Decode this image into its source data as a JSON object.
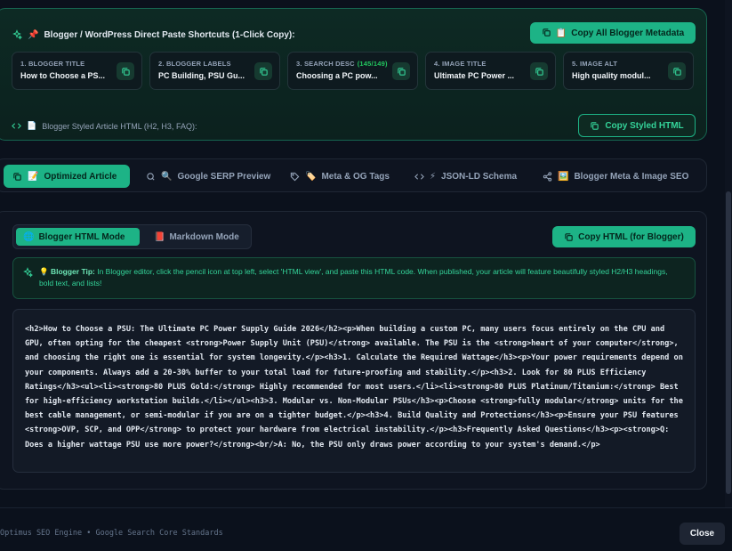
{
  "shortcuts": {
    "pin_emoji": "📌",
    "title": "Blogger / WordPress Direct Paste Shortcuts (1-Click Copy):",
    "copy_all_emoji": "📋",
    "copy_all_label": "Copy All Blogger Metadata",
    "fields": [
      {
        "label": "1. BLOGGER TITLE",
        "count": "",
        "value": "How to Choose a PS..."
      },
      {
        "label": "2. BLOGGER LABELS",
        "count": "",
        "value": "PC Building, PSU Gu..."
      },
      {
        "label": "3. SEARCH DESC",
        "count": "(145/149)",
        "value": "Choosing a PC pow..."
      },
      {
        "label": "4. IMAGE TITLE",
        "count": "",
        "value": "Ultimate PC Power ..."
      },
      {
        "label": "5. IMAGE ALT",
        "count": "",
        "value": "High quality modul..."
      }
    ],
    "styled_emoji": "📄",
    "styled_label": "Blogger Styled Article HTML (H2, H3, FAQ):",
    "copy_styled_label": "Copy Styled HTML"
  },
  "tabs": [
    {
      "emoji": "📝",
      "label": "Optimized Article",
      "icon": "document-icon"
    },
    {
      "emoji": "🔍",
      "label": "Google SERP Preview",
      "icon": "search-icon"
    },
    {
      "emoji": "🏷️",
      "label": "Meta & OG Tags",
      "icon": "tag-icon"
    },
    {
      "emoji": "⚡",
      "label": "JSON-LD Schema",
      "icon": "code-icon"
    },
    {
      "emoji": "🖼️",
      "label": "Blogger Meta & Image SEO",
      "icon": "share-icon"
    }
  ],
  "modes": {
    "html_emoji": "🌐",
    "html_label": "Blogger HTML Mode",
    "md_emoji": "📕",
    "md_label": "Markdown Mode"
  },
  "copy_html_label": "Copy HTML (for Blogger)",
  "tip": {
    "emoji": "💡",
    "title": "Blogger Tip:",
    "text": " In Blogger editor, click the pencil icon at top left, select 'HTML view', and paste this HTML code. When published, your article will feature beautifully styled H2/H3 headings, bold text, and lists!"
  },
  "code": "<h2>How to Choose a PSU: The Ultimate PC Power Supply Guide 2026</h2><p>When building a custom PC, many users focus entirely on the CPU and GPU, often opting for the cheapest <strong>Power Supply Unit (PSU)</strong> available. The PSU is the <strong>heart of your computer</strong>, and choosing the right one is essential for system longevity.</p><h3>1. Calculate the Required Wattage</h3><p>Your power requirements depend on your components. Always add a 20-30% buffer to your total load for future-proofing and stability.</p><h3>2. Look for 80 PLUS Efficiency Ratings</h3><ul><li><strong>80 PLUS Gold:</strong> Highly recommended for most users.</li><li><strong>80 PLUS Platinum/Titanium:</strong> Best for high-efficiency workstation builds.</li></ul><h3>3. Modular vs. Non-Modular PSUs</h3><p>Choose <strong>fully modular</strong> units for the best cable management, or semi-modular if you are on a tighter budget.</p><h3>4. Build Quality and Protections</h3><p>Ensure your PSU features <strong>OVP, SCP, and OPP</strong> to protect your hardware from electrical instability.</p><h3>Frequently Asked Questions</h3><p><strong>Q: Does a higher wattage PSU use more power?</strong><br/>A: No, the PSU only draws power according to your system's demand.</p>",
  "footer": {
    "text": "Optimus SEO Engine • Google Search Core Standards",
    "close_label": "Close"
  },
  "colors": {
    "accent": "#1db386",
    "tip_text": "#34d399",
    "background": "#0b111c"
  }
}
